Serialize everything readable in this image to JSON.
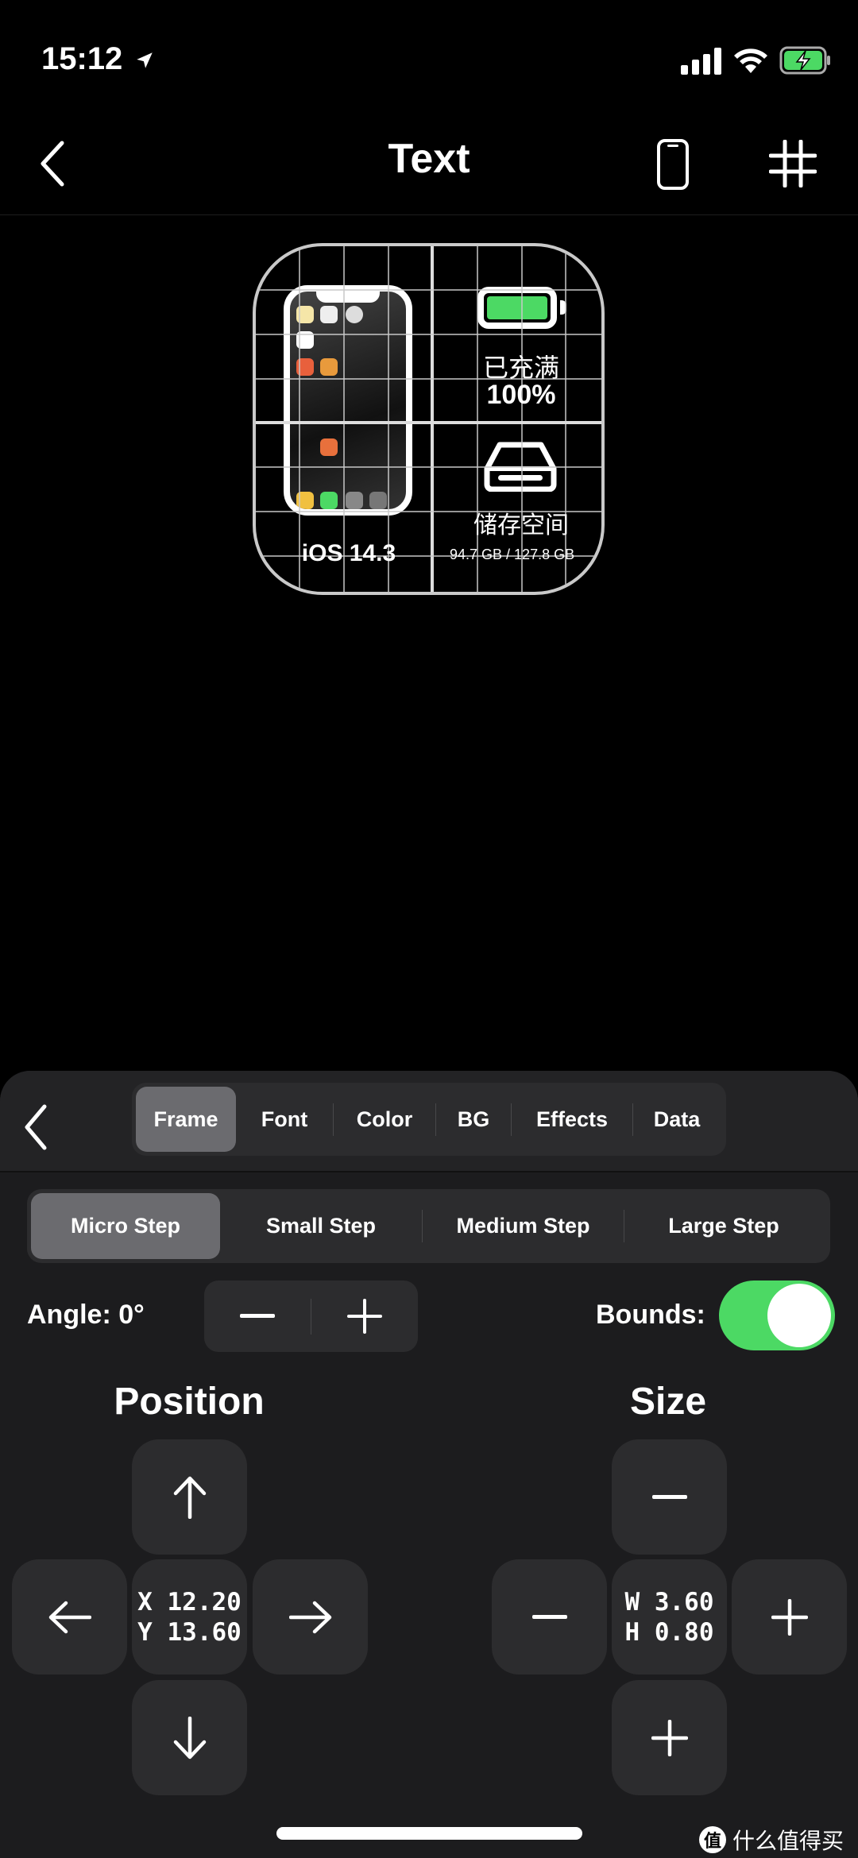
{
  "status_bar": {
    "time": "15:12",
    "icons": [
      "location-arrow-icon",
      "signal-icon",
      "wifi-icon",
      "battery-charging-icon"
    ]
  },
  "nav": {
    "title": "Text",
    "back_icon": "chevron-left-icon",
    "device_icon": "phone-icon",
    "grid_icon": "grid-icon"
  },
  "widget": {
    "os_label": "iOS 14.3",
    "battery_status": "已充满",
    "battery_percent": "100%",
    "battery_level": 1.0,
    "storage_label": "储存空间",
    "storage_value": "94.7 GB / 127.8 GB"
  },
  "panel": {
    "tabs": [
      {
        "label": "Frame",
        "selected": true
      },
      {
        "label": "Font"
      },
      {
        "label": "Color"
      },
      {
        "label": "BG"
      },
      {
        "label": "Effects"
      },
      {
        "label": "Data"
      }
    ],
    "steps": [
      {
        "label": "Micro Step",
        "selected": true
      },
      {
        "label": "Small Step"
      },
      {
        "label": "Medium Step"
      },
      {
        "label": "Large Step"
      }
    ],
    "angle_label": "Angle: 0°",
    "bounds_label": "Bounds:",
    "bounds_on": true,
    "position": {
      "title": "Position",
      "x_line": "X 12.20",
      "y_line": "Y 13.60"
    },
    "size": {
      "title": "Size",
      "w_line": "W 3.60",
      "h_line": "H 0.80"
    }
  },
  "watermark": {
    "logo": "值",
    "text": "什么值得买"
  },
  "colors": {
    "accent_green": "#4cd964",
    "panel_bg": "#1c1c1e",
    "button_bg": "#2c2c2e"
  }
}
